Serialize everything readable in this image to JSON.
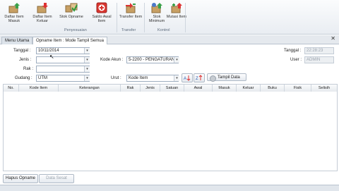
{
  "ribbon": {
    "buttons": [
      {
        "label": "Daftar Item Masuk",
        "icon": "box-in-icon"
      },
      {
        "label": "Daftar Item Keluar",
        "icon": "box-out-icon"
      },
      {
        "label": "Stok Opname",
        "icon": "stock-opname-icon"
      },
      {
        "label": "Saldo Awal Item",
        "icon": "first-aid-box-icon"
      },
      {
        "label": "Transfer Item",
        "icon": "transfer-icon"
      },
      {
        "label": "Stok Minimum",
        "icon": "stock-min-icon"
      },
      {
        "label": "Mutasi Item",
        "icon": "mutation-icon"
      }
    ],
    "groups": [
      "Penyesuaian",
      "Transfer",
      "Kontrol"
    ]
  },
  "tabs": [
    "Menu Utama",
    "Opname Item : Mode Tampil Semua"
  ],
  "form": {
    "tanggal_label": "Tanggal :",
    "tanggal_value": "10/11/2014",
    "jenis_label": "Jenis :",
    "rak_label": "Rak :",
    "gudang_label": "Gudang :",
    "gudang_value": "UTM",
    "kode_akun_label": "Kode Akun :",
    "kode_akun_value": "5-2200 - PENGATURAN",
    "urut_label": "Urut :",
    "urut_value": "Kode Item",
    "tampil_label": "Tampil Data",
    "tanggal2_label": "Tanggal :",
    "tanggal2_value": "22:28:23",
    "user_label": "User :",
    "user_value": "ADMIN"
  },
  "grid": {
    "columns": [
      "No.",
      "Kode Item",
      "Keterangan",
      "Rak",
      "Jenis",
      "Satuan",
      "Awal",
      "Masuk",
      "Keluar",
      "Buku",
      "Fisik",
      "Selisih"
    ]
  },
  "buttons": {
    "hapus": "Hapus Opname",
    "data_sesat": "Data Sesat"
  }
}
